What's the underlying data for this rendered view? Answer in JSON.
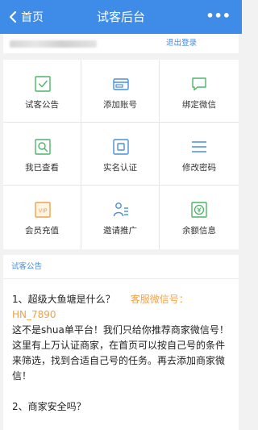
{
  "header": {
    "back_label": "首页",
    "title": "试客后台",
    "more_label": "•••"
  },
  "userbar": {
    "logout_label": "退出登录"
  },
  "menu": {
    "items": [
      {
        "label": "试客公告",
        "icon": "check-square-icon"
      },
      {
        "label": "添加账号",
        "icon": "card-icon"
      },
      {
        "label": "绑定微信",
        "icon": "chat-bubble-icon"
      },
      {
        "label": "我已查看",
        "icon": "search-icon"
      },
      {
        "label": "实名认证",
        "icon": "id-square-icon"
      },
      {
        "label": "修改密码",
        "icon": "lines-icon"
      },
      {
        "label": "会员充值",
        "icon": "vip-icon"
      },
      {
        "label": "邀请推广",
        "icon": "invite-icon"
      },
      {
        "label": "余额信息",
        "icon": "balance-icon"
      }
    ]
  },
  "notice": {
    "heading": "试客公告",
    "q1_title": "1、超级大鱼塘是什么？",
    "q1_service": "客服微信号：",
    "q1_service_id": "HN_7890",
    "q1_answer": "这不是shua单平台！我们只给你推荐商家微信号！这里有上万认证商家，在首页可以按自己号的条件来筛选，找到合适自己号的任务。再去添加商家微信！",
    "q2_title": "2、商家安全吗？"
  },
  "colors": {
    "brand_blue": "#3f8be8",
    "icon_green": "#4fb36a",
    "icon_blue": "#4a8fe0",
    "icon_orange": "#f0a24a",
    "accent_orange": "#f0a24a"
  }
}
